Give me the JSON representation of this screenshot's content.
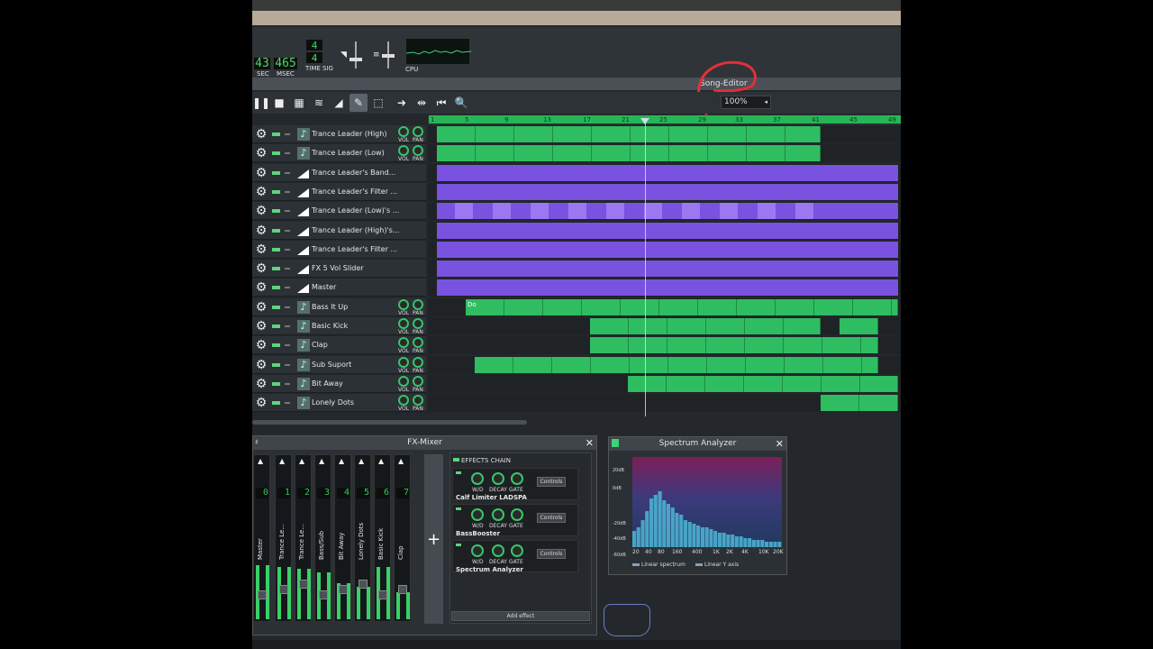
{
  "topbar": {
    "sec": "43",
    "msec": "465",
    "sec_label": "SEC",
    "msec_label": "MSEC",
    "timesig_num": "4",
    "timesig_den": "4",
    "timesig_label": "TIME SIG",
    "cpu_label": "CPU"
  },
  "song_editor": {
    "title": "Song-Editor",
    "zoom": "100%",
    "timeline_ticks": [
      "1",
      "5",
      "9",
      "13",
      "17",
      "21",
      "25",
      "29",
      "33",
      "37",
      "41",
      "45",
      "49"
    ]
  },
  "tracks": [
    {
      "name": "Trance Leader (High)",
      "type": "instrument",
      "vol": "VOL",
      "pan": "PAN"
    },
    {
      "name": "Trance Leader (Low)",
      "type": "instrument",
      "vol": "VOL",
      "pan": "PAN"
    },
    {
      "name": "Trance Leader's Band...",
      "type": "automation"
    },
    {
      "name": "Trance Leader's Filter ...",
      "type": "automation"
    },
    {
      "name": "Trance Leader (Low)'s ...",
      "type": "automation"
    },
    {
      "name": "Trance Leader (High)'s...",
      "type": "automation"
    },
    {
      "name": "Trance Leader's Filter ...",
      "type": "automation"
    },
    {
      "name": "FX 5 Vol Slider",
      "type": "automation"
    },
    {
      "name": "Master",
      "type": "automation"
    },
    {
      "name": "Bass It Up",
      "type": "instrument",
      "vol": "VOL",
      "pan": "PAN",
      "clip_label": "Do"
    },
    {
      "name": "Basic Kick",
      "type": "instrument",
      "vol": "VOL",
      "pan": "PAN"
    },
    {
      "name": "Clap",
      "type": "instrument",
      "vol": "VOL",
      "pan": "PAN"
    },
    {
      "name": "Sub Suport",
      "type": "instrument",
      "vol": "VOL",
      "pan": "PAN"
    },
    {
      "name": "Bit Away",
      "type": "instrument",
      "vol": "VOL",
      "pan": "PAN"
    },
    {
      "name": "Lonely Dots",
      "type": "instrument",
      "vol": "VOL",
      "pan": "PAN"
    }
  ],
  "fx_mixer": {
    "title": "FX-Mixer",
    "channels": [
      {
        "num": "0",
        "name": "Master"
      },
      {
        "num": "1",
        "name": "Trance Le..."
      },
      {
        "num": "2",
        "name": "Trance Le..."
      },
      {
        "num": "3",
        "name": "Bass/Sub"
      },
      {
        "num": "4",
        "name": "Bit Away"
      },
      {
        "num": "5",
        "name": "Lonely Dots"
      },
      {
        "num": "6",
        "name": "Basic Kick"
      },
      {
        "num": "7",
        "name": "Clap"
      }
    ],
    "add_channel": "+",
    "effects_chain_label": "EFFECTS CHAIN",
    "effects": [
      {
        "name": "Calf Limiter LADSPA",
        "k1": "W/D",
        "k2": "DECAY",
        "k3": "GATE",
        "controls": "Controls"
      },
      {
        "name": "BassBooster",
        "k1": "W/D",
        "k2": "DECAY",
        "k3": "GATE",
        "controls": "Controls"
      },
      {
        "name": "Spectrum Analyzer",
        "k1": "W/D",
        "k2": "DECAY",
        "k3": "GATE",
        "controls": "Controls"
      }
    ],
    "add_effect": "Add effect"
  },
  "spectrum": {
    "title": "Spectrum Analyzer",
    "y_labels": [
      "20dB",
      "0dB",
      "-20dB",
      "-40dB",
      "-60dB"
    ],
    "x_labels": [
      "20",
      "40",
      "80",
      "160",
      "400",
      "1K",
      "2K",
      "4K",
      "10K",
      "20K"
    ],
    "legend_linear": "Linear spectrum",
    "legend_y": "Linear Y axis"
  }
}
